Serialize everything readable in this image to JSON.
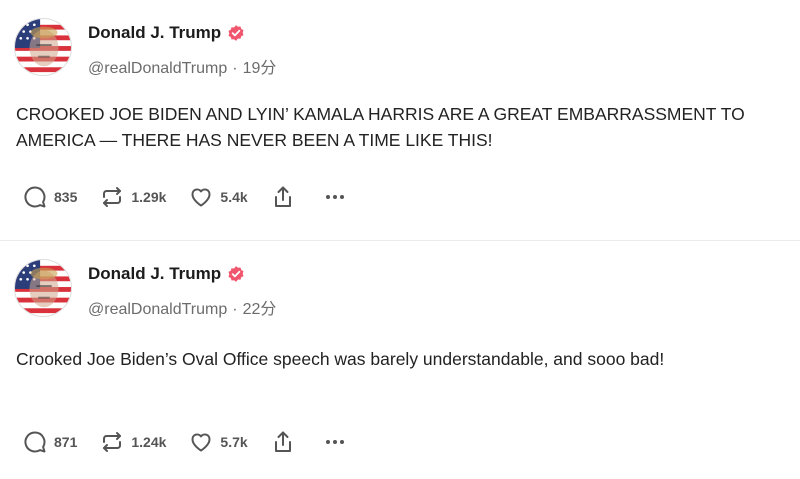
{
  "posts": [
    {
      "author": "Donald J. Trump",
      "handle": "@realDonaldTrump",
      "separator": "·",
      "time": "19分",
      "text": "CROOKED JOE BIDEN AND LYIN’ KAMALA HARRIS ARE A GREAT EMBARRASSMENT TO AMERICA — THERE HAS NEVER BEEN A TIME LIKE THIS!",
      "replies": "835",
      "reposts": "1.29k",
      "likes": "5.4k"
    },
    {
      "author": "Donald J. Trump",
      "handle": "@realDonaldTrump",
      "separator": "·",
      "time": "22分",
      "text": "Crooked Joe Biden’s Oval Office speech was barely understandable, and sooo bad!",
      "replies": "871",
      "reposts": "1.24k",
      "likes": "5.7k"
    }
  ],
  "colors": {
    "verified_badge": "#f0576e",
    "icon": "#555555",
    "handle": "#6c6c6c",
    "divider": "#ececec"
  },
  "icons": {
    "reply": "reply-icon",
    "repost": "repost-icon",
    "like": "heart-icon",
    "share": "share-icon",
    "more": "more-icon",
    "verified": "verified-badge-icon"
  }
}
